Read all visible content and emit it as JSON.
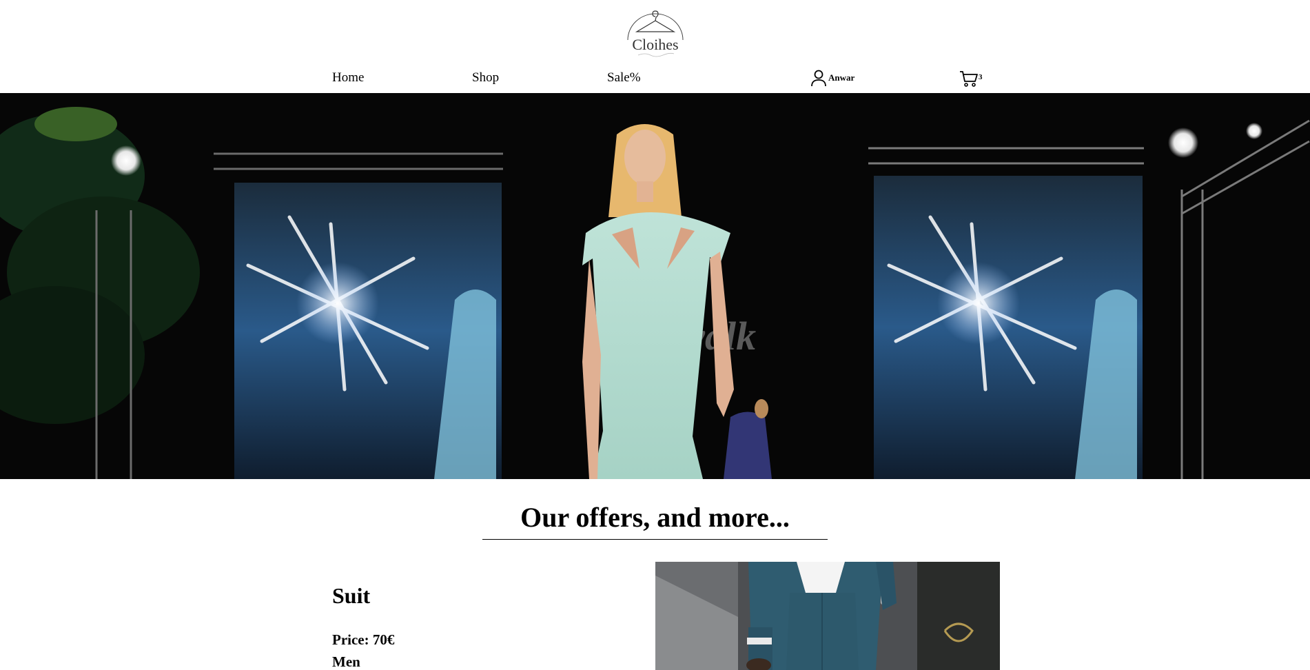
{
  "brand": {
    "logo_text": "Cloihes"
  },
  "nav": {
    "home": "Home",
    "shop": "Shop",
    "sale": "Sale%",
    "user_name": "Anwar",
    "cart_count": "3"
  },
  "hero": {
    "image_alt": "",
    "screen_text": "#D          twalk"
  },
  "offers": {
    "title": "Our offers, and more...",
    "product": {
      "name": "Suit",
      "price": "Price: 70€",
      "category": "Men"
    }
  },
  "icons": {
    "user": "user-icon",
    "cart": "cart-icon"
  }
}
